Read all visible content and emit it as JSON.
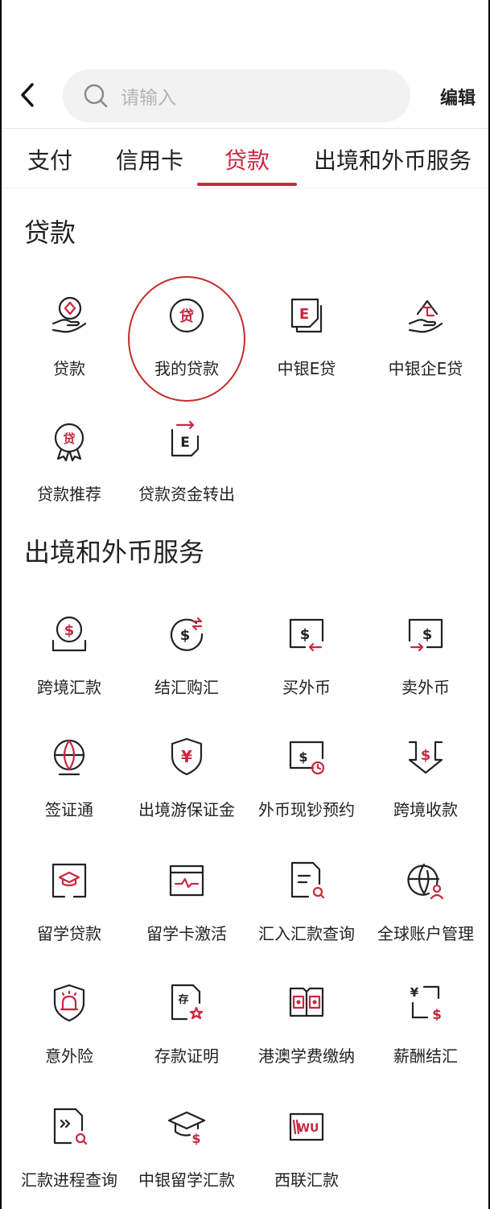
{
  "header": {
    "search_placeholder": "请输入",
    "edit_label": "编辑"
  },
  "tabs": [
    {
      "label": "支付",
      "active": false
    },
    {
      "label": "信用卡",
      "active": false
    },
    {
      "label": "贷款",
      "active": true
    },
    {
      "label": "出境和外币服务",
      "active": false
    }
  ],
  "colors": {
    "accent": "#c8283f",
    "text": "#222222",
    "placeholder": "#b4b4b4"
  },
  "sections": [
    {
      "title": "贷款",
      "items": [
        {
          "label": "贷款",
          "icon": "hand-diamond-icon"
        },
        {
          "label": "我的贷款",
          "icon": "loan-coin-icon"
        },
        {
          "label": "中银E贷",
          "icon": "e-loan-doc-icon"
        },
        {
          "label": "中银企E贷",
          "icon": "hand-building-icon"
        },
        {
          "label": "贷款推荐",
          "icon": "loan-badge-icon"
        },
        {
          "label": "贷款资金转出",
          "icon": "e-transfer-doc-icon"
        }
      ]
    },
    {
      "title": "出境和外币服务",
      "items": [
        {
          "label": "跨境汇款",
          "icon": "dollar-coin-tray-icon"
        },
        {
          "label": "结汇购汇",
          "icon": "dollar-exchange-icon"
        },
        {
          "label": "买外币",
          "icon": "buy-currency-icon"
        },
        {
          "label": "卖外币",
          "icon": "sell-currency-icon"
        },
        {
          "label": "签证通",
          "icon": "globe-icon"
        },
        {
          "label": "出境游保证金",
          "icon": "yuan-shield-icon"
        },
        {
          "label": "外币现钞预约",
          "icon": "cash-clock-icon"
        },
        {
          "label": "跨境收款",
          "icon": "dollar-receive-icon"
        },
        {
          "label": "留学贷款",
          "icon": "graduation-book-icon"
        },
        {
          "label": "留学卡激活",
          "icon": "card-pulse-icon"
        },
        {
          "label": "汇入汇款查询",
          "icon": "doc-search-icon"
        },
        {
          "label": "全球账户管理",
          "icon": "globe-user-icon"
        },
        {
          "label": "意外险",
          "icon": "shield-alarm-icon"
        },
        {
          "label": "存款证明",
          "icon": "deposit-certificate-icon"
        },
        {
          "label": "港澳学费缴纳",
          "icon": "hk-macau-book-icon"
        },
        {
          "label": "薪酬结汇",
          "icon": "salary-exchange-icon"
        },
        {
          "label": "汇款进程查询",
          "icon": "remit-progress-icon"
        },
        {
          "label": "中银留学汇款",
          "icon": "grad-cap-dollar-icon"
        },
        {
          "label": "西联汇款",
          "icon": "western-union-icon"
        }
      ]
    }
  ]
}
